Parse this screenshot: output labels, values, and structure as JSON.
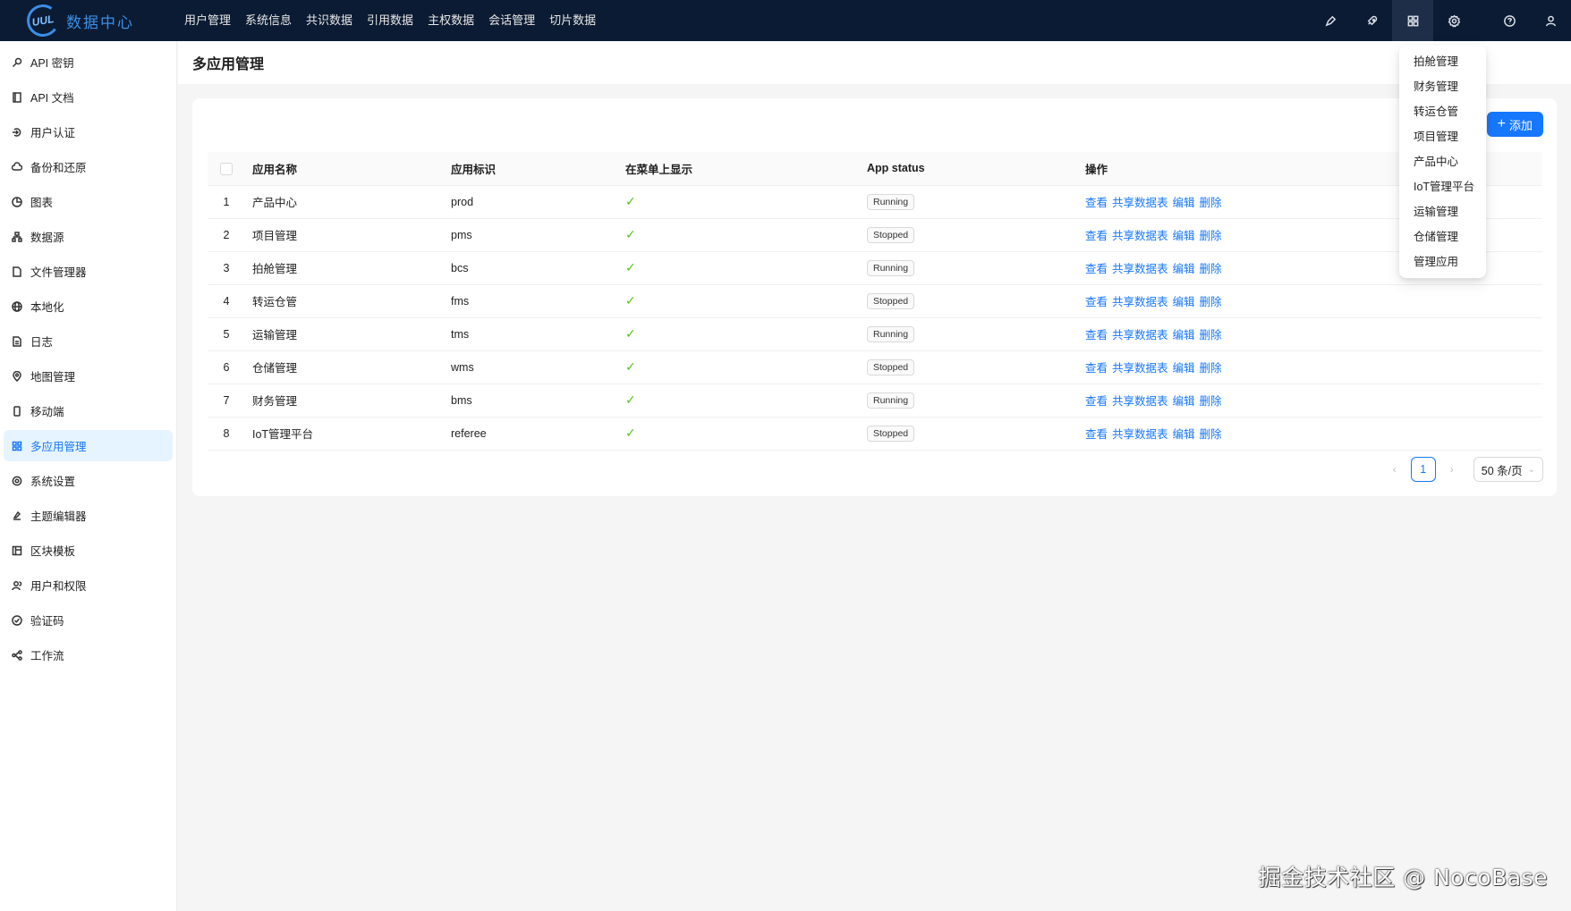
{
  "app": {
    "logo_mark": "UUL",
    "logo_text": "数据中心"
  },
  "topnav": [
    {
      "label": "用户管理"
    },
    {
      "label": "系统信息"
    },
    {
      "label": "共识数据"
    },
    {
      "label": "引用数据"
    },
    {
      "label": "主权数据"
    },
    {
      "label": "会话管理"
    },
    {
      "label": "切片数据"
    }
  ],
  "toolbar_icons": [
    "pen-icon",
    "rocket-icon",
    "apps-grid-icon",
    "gear-icon",
    "help-icon",
    "user-icon"
  ],
  "sidebar": {
    "items": [
      {
        "label": "API 密钥",
        "icon": "key-icon"
      },
      {
        "label": "API 文档",
        "icon": "book-icon"
      },
      {
        "label": "用户认证",
        "icon": "login-icon"
      },
      {
        "label": "备份和还原",
        "icon": "cloud-icon"
      },
      {
        "label": "图表",
        "icon": "pie-chart-icon"
      },
      {
        "label": "数据源",
        "icon": "database-icon"
      },
      {
        "label": "文件管理器",
        "icon": "file-icon"
      },
      {
        "label": "本地化",
        "icon": "globe-icon"
      },
      {
        "label": "日志",
        "icon": "log-icon"
      },
      {
        "label": "地图管理",
        "icon": "location-icon"
      },
      {
        "label": "移动端",
        "icon": "mobile-icon"
      },
      {
        "label": "多应用管理",
        "icon": "apps-icon",
        "active": true
      },
      {
        "label": "系统设置",
        "icon": "gear-icon"
      },
      {
        "label": "主题编辑器",
        "icon": "theme-icon"
      },
      {
        "label": "区块模板",
        "icon": "layout-icon"
      },
      {
        "label": "用户和权限",
        "icon": "users-icon"
      },
      {
        "label": "验证码",
        "icon": "check-circle-icon"
      },
      {
        "label": "工作流",
        "icon": "workflow-icon"
      }
    ]
  },
  "page": {
    "title": "多应用管理",
    "add_label": "添加"
  },
  "table": {
    "columns": [
      "应用名称",
      "应用标识",
      "在菜单上显示",
      "App status",
      "操作"
    ],
    "rows": [
      {
        "index": "1",
        "name": "产品中心",
        "key": "prod",
        "status": "Running"
      },
      {
        "index": "2",
        "name": "项目管理",
        "key": "pms",
        "status": "Stopped"
      },
      {
        "index": "3",
        "name": "拍舱管理",
        "key": "bcs",
        "status": "Running"
      },
      {
        "index": "4",
        "name": "转运仓管",
        "key": "fms",
        "status": "Stopped"
      },
      {
        "index": "5",
        "name": "运输管理",
        "key": "tms",
        "status": "Running"
      },
      {
        "index": "6",
        "name": "仓储管理",
        "key": "wms",
        "status": "Stopped"
      },
      {
        "index": "7",
        "name": "财务管理",
        "key": "bms",
        "status": "Running"
      },
      {
        "index": "8",
        "name": "IoT管理平台",
        "key": "referee",
        "status": "Stopped"
      }
    ],
    "actions": [
      "查看",
      "共享数据表",
      "编辑",
      "删除"
    ],
    "check_glyph": "✓"
  },
  "pagination": {
    "prev": "‹",
    "next": "›",
    "current": "1",
    "page_size": "50 条/页",
    "chevron": "⌄"
  },
  "dropdown": {
    "items": [
      "拍舱管理",
      "财务管理",
      "转运仓管",
      "项目管理",
      "产品中心",
      "IoT管理平台",
      "运输管理",
      "仓储管理",
      "管理应用"
    ]
  },
  "watermark": "掘金技术社区 @ NocoBase",
  "colors": {
    "topbar": "#0b1b33",
    "primary": "#1677ff",
    "success": "#52c41a"
  }
}
